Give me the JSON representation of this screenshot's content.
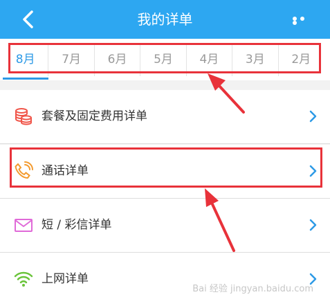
{
  "header": {
    "title": "我的详单"
  },
  "months": [
    "8月",
    "7月",
    "6月",
    "5月",
    "4月",
    "3月",
    "2月"
  ],
  "rows": [
    {
      "label": "套餐及固定费用详单",
      "icon": "coins-icon",
      "color": "#f0564a"
    },
    {
      "label": "通话详单",
      "icon": "phone-call-icon",
      "color": "#f39a2e"
    },
    {
      "label": "短 / 彩信详单",
      "icon": "envelope-icon",
      "color": "#e06ad8"
    },
    {
      "label": "上网详单",
      "icon": "wifi-icon",
      "color": "#6ac43a"
    }
  ],
  "watermark": "Bai 经验 jingyan.baidu.com",
  "colors": {
    "header": "#2da7f1",
    "accent": "#2d9ae6",
    "annotation": "#e8323a"
  }
}
